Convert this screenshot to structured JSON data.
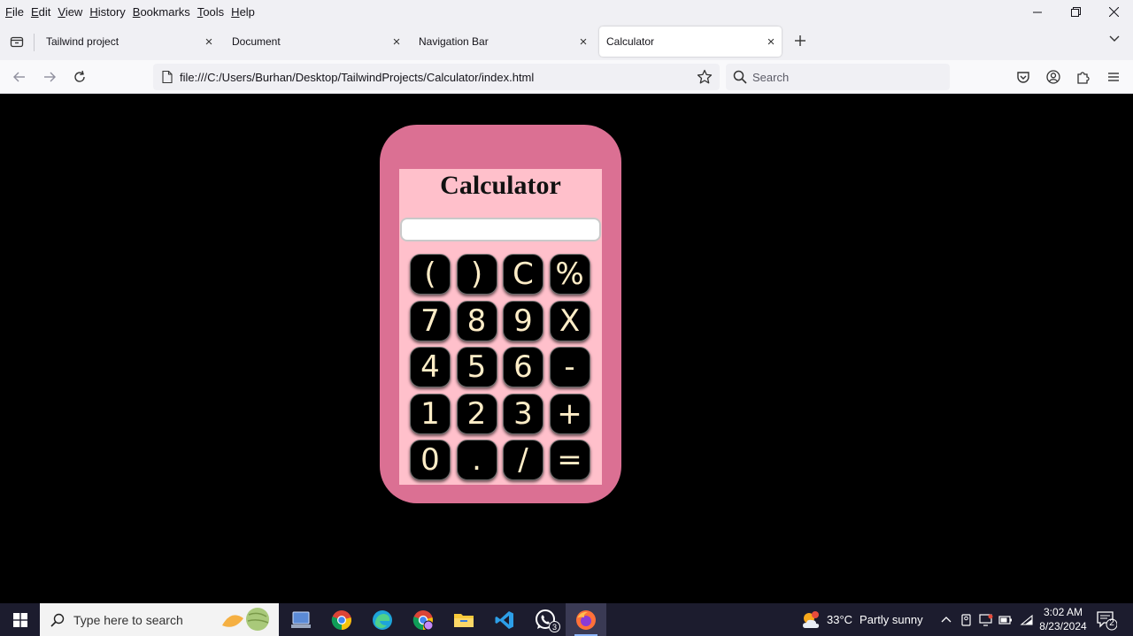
{
  "menubar": {
    "items": [
      "File",
      "Edit",
      "View",
      "History",
      "Bookmarks",
      "Tools",
      "Help"
    ]
  },
  "tabs": [
    {
      "label": "Tailwind project",
      "active": false
    },
    {
      "label": "Document",
      "active": false
    },
    {
      "label": "Navigation Bar",
      "active": false
    },
    {
      "label": "Calculator",
      "active": true
    }
  ],
  "navbar": {
    "url": "file:///C:/Users/Burhan/Desktop/TailwindProjects/Calculator/index.html",
    "search_placeholder": "Search"
  },
  "calculator": {
    "title": "Calculator",
    "display_value": "",
    "keys": [
      "(",
      ")",
      "C",
      "%",
      "7",
      "8",
      "9",
      "X",
      "4",
      "5",
      "6",
      "-",
      "1",
      "2",
      "3",
      "+",
      "0",
      ".",
      "/",
      "="
    ],
    "colors": {
      "outer": "#db7093",
      "inner": "#ffc0cb",
      "key_bg": "#000000",
      "key_text": "#ffedc7"
    }
  },
  "taskbar": {
    "search_placeholder": "Type here to search",
    "whatsapp_badge": "3",
    "weather_temp": "33°C",
    "weather_desc": "Partly sunny",
    "weather_alert": "1",
    "time": "3:02 AM",
    "date": "8/23/2024",
    "notification_count": "2"
  }
}
